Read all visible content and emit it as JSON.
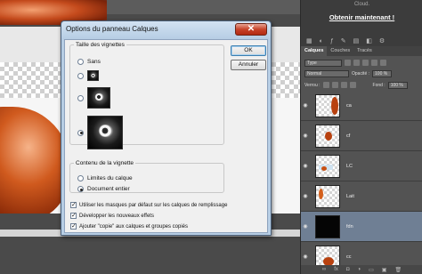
{
  "promo": {
    "title": "Cloud.",
    "link": "Obtenir maintenant !"
  },
  "panel": {
    "tabs": [
      "Calques",
      "Couches",
      "Tracés"
    ],
    "filter_label": "Type",
    "blend_mode": "Normal",
    "opacity_label": "Opacité :",
    "opacity_value": "100 %",
    "lock_label": "Verrou :",
    "fill_label": "Fond :",
    "fill_value": "100 %",
    "layers": [
      {
        "name": "ca",
        "selected": false
      },
      {
        "name": "cf",
        "selected": false
      },
      {
        "name": "LC",
        "selected": false
      },
      {
        "name": "Lait",
        "selected": false
      },
      {
        "name": "fdn",
        "selected": true
      },
      {
        "name": "cc",
        "selected": false
      }
    ],
    "footer_icons": [
      "link-icon",
      "fx-icon",
      "mask-icon",
      "adjustment-icon",
      "folder-icon",
      "new-layer-icon",
      "trash-icon"
    ]
  },
  "dialog": {
    "title": "Options du panneau Calques",
    "close_glyph": "✕",
    "thumbnail_group": {
      "legend": "Taille des vignettes",
      "options": [
        "Sans",
        "Petite",
        "Moyenne",
        "Grande"
      ],
      "selected": "Grande",
      "first_label": "Sans"
    },
    "content_group": {
      "legend": "Contenu de la vignette",
      "options": [
        "Limites du calque",
        "Document entier"
      ],
      "selected": "Document entier"
    },
    "checkboxes": [
      {
        "label": "Utiliser les masques par défaut sur les calques de remplissage",
        "checked": true
      },
      {
        "label": "Développer les nouveaux effets",
        "checked": true
      },
      {
        "label": "Ajouter \"copie\" aux calques et groupes copiés",
        "checked": true
      }
    ],
    "ok_label": "OK",
    "cancel_label": "Annuler"
  }
}
